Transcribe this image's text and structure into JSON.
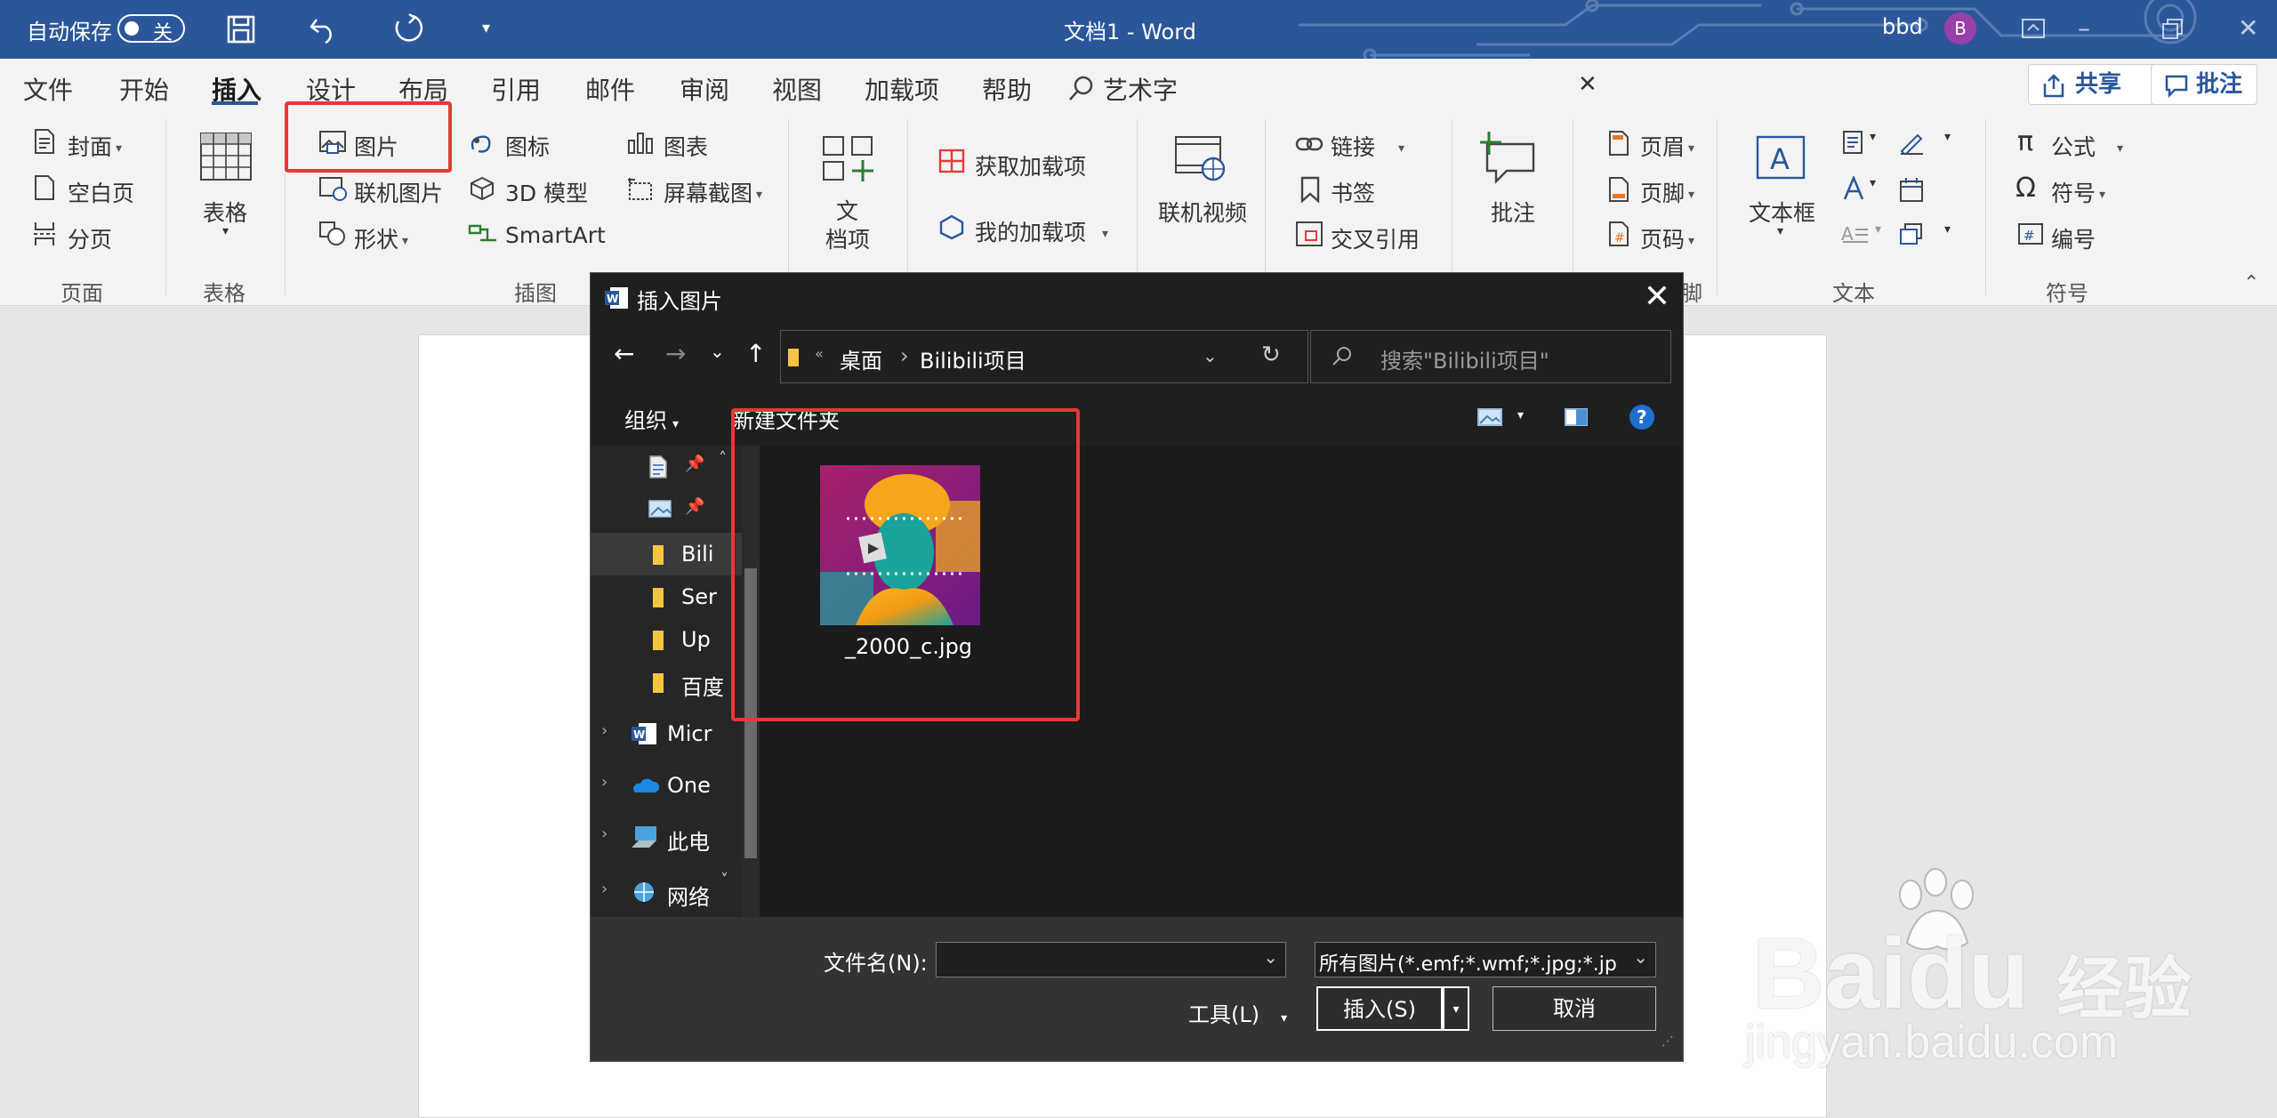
{
  "titlebar": {
    "autosave_label": "自动保存",
    "autosave_state": "关",
    "doc_title": "文档1  -  Word",
    "user": "bbd",
    "avatar_initial": "B"
  },
  "tabs": [
    "文件",
    "开始",
    "插入",
    "设计",
    "布局",
    "引用",
    "邮件",
    "审阅",
    "视图",
    "加载项",
    "帮助",
    "艺术字"
  ],
  "active_tab": "插入",
  "share_label": "共享",
  "comment_label": "批注",
  "ribbon": {
    "pages": {
      "cover": "封面",
      "blank": "空白页",
      "break": "分页",
      "group": "页面"
    },
    "tables": {
      "table": "表格",
      "group": "表格"
    },
    "illustrations": {
      "picture": "图片",
      "online_picture": "联机图片",
      "shapes": "形状",
      "icons": "图标",
      "model3d": "3D 模型",
      "smartart": "SmartArt",
      "chart": "图表",
      "screenshot": "屏幕截图",
      "group": "插图"
    },
    "docitem": {
      "label_line1": "文",
      "label_line2": "档项"
    },
    "addins": {
      "get": "获取加载项",
      "mine": "我的加载项"
    },
    "media": {
      "online_video": "联机视频"
    },
    "links": {
      "link": "链接",
      "bookmark": "书签",
      "crossref": "交叉引用"
    },
    "comments": {
      "comment": "批注"
    },
    "headerfooter": {
      "header": "页眉",
      "footer": "页脚",
      "pagenum": "页码",
      "group_partial": "脚"
    },
    "text": {
      "textbox": "文本框",
      "group": "文本"
    },
    "symbols": {
      "equation": "公式",
      "symbol": "符号",
      "number": "编号",
      "group": "符号"
    }
  },
  "dialog": {
    "title": "插入图片",
    "path": [
      "桌面",
      "Bilibili项目"
    ],
    "search_placeholder": "搜索\"Bilibili项目\"",
    "organize": "组织",
    "new_folder": "新建文件夹",
    "nav_items": [
      "Bili",
      "Ser",
      "Up",
      "百度",
      "Micr",
      "One",
      "此电",
      "网络"
    ],
    "file": {
      "name": "_2000_c.jpg"
    },
    "filename_label": "文件名(N):",
    "filename_value": "",
    "filetype": "所有图片(*.emf;*.wmf;*.jpg;*.jp",
    "tools": "工具(L)",
    "insert": "插入(S)",
    "cancel": "取消"
  },
  "watermark": {
    "brand": "Baidu",
    "brand_cn": "经验",
    "url": "jingyan.baidu.com"
  },
  "colors": {
    "word_blue": "#2b579a",
    "highlight_red": "#e53935",
    "dialog_bg": "#1f1f1f"
  }
}
